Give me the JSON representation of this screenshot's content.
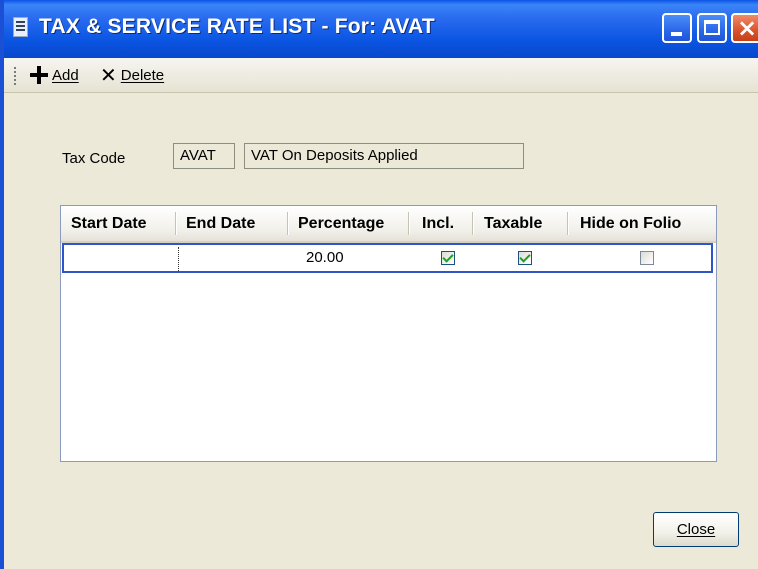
{
  "window": {
    "title": "TAX & SERVICE RATE LIST - For: AVAT",
    "controls": {
      "minimize": "minimize",
      "maximize": "maximize",
      "close": "×"
    }
  },
  "toolbar": {
    "add_label": "Add",
    "delete_label": "Delete",
    "add_icon": "plus-icon",
    "delete_icon": "x-icon"
  },
  "form": {
    "tax_code_label": "Tax Code",
    "tax_code_value": "AVAT",
    "tax_description": "VAT On Deposits Applied"
  },
  "grid": {
    "columns": [
      "Start Date",
      "End Date",
      "Percentage",
      "Incl.",
      "Taxable",
      "Hide on Folio"
    ],
    "rows": [
      {
        "start_date": "",
        "end_date": "",
        "percentage": "20.00",
        "incl": true,
        "taxable": true,
        "hide_on_folio": false
      }
    ]
  },
  "footer": {
    "close_label": "Close"
  },
  "colors": {
    "titlebar": "#0a55e2",
    "face": "#ece9d8",
    "selection_border": "#2f56c8",
    "check": "#21a121"
  }
}
